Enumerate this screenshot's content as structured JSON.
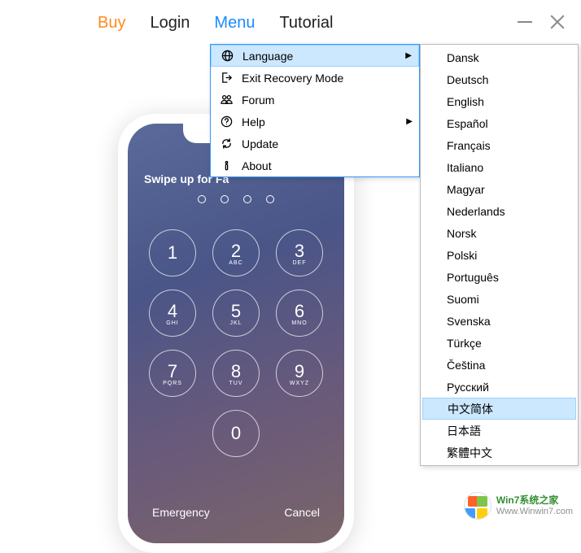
{
  "nav": {
    "buy": "Buy",
    "login": "Login",
    "menu": "Menu",
    "tutorial": "Tutorial"
  },
  "phone": {
    "swipe_text": "Swipe up for Fa",
    "keys": [
      {
        "num": "1",
        "ltr": ""
      },
      {
        "num": "2",
        "ltr": "ABC"
      },
      {
        "num": "3",
        "ltr": "DEF"
      },
      {
        "num": "4",
        "ltr": "GHI"
      },
      {
        "num": "5",
        "ltr": "JKL"
      },
      {
        "num": "6",
        "ltr": "MNO"
      },
      {
        "num": "7",
        "ltr": "PQRS"
      },
      {
        "num": "8",
        "ltr": "TUV"
      },
      {
        "num": "9",
        "ltr": "WXYZ"
      },
      {
        "num": "0",
        "ltr": ""
      }
    ],
    "emergency": "Emergency",
    "cancel": "Cancel"
  },
  "menu": {
    "items": [
      {
        "label": "Language",
        "icon": "globe",
        "arrow": true,
        "highlight": true
      },
      {
        "label": "Exit Recovery Mode",
        "icon": "exit",
        "arrow": false,
        "highlight": false
      },
      {
        "label": "Forum",
        "icon": "users",
        "arrow": false,
        "highlight": false
      },
      {
        "label": "Help",
        "icon": "help",
        "arrow": true,
        "highlight": false
      },
      {
        "label": "Update",
        "icon": "refresh",
        "arrow": false,
        "highlight": false
      },
      {
        "label": "About",
        "icon": "info",
        "arrow": false,
        "highlight": false
      }
    ]
  },
  "languages": [
    {
      "label": "Dansk",
      "highlight": false
    },
    {
      "label": "Deutsch",
      "highlight": false
    },
    {
      "label": "English",
      "highlight": false
    },
    {
      "label": "Español",
      "highlight": false
    },
    {
      "label": "Français",
      "highlight": false
    },
    {
      "label": "Italiano",
      "highlight": false
    },
    {
      "label": "Magyar",
      "highlight": false
    },
    {
      "label": "Nederlands",
      "highlight": false
    },
    {
      "label": "Norsk",
      "highlight": false
    },
    {
      "label": "Polski",
      "highlight": false
    },
    {
      "label": "Português",
      "highlight": false
    },
    {
      "label": "Suomi",
      "highlight": false
    },
    {
      "label": "Svenska",
      "highlight": false
    },
    {
      "label": "Türkçe",
      "highlight": false
    },
    {
      "label": "Čeština",
      "highlight": false
    },
    {
      "label": "Русский",
      "highlight": false
    },
    {
      "label": "中文简体",
      "highlight": true
    },
    {
      "label": "日本語",
      "highlight": false
    },
    {
      "label": "繁體中文",
      "highlight": false
    }
  ],
  "watermark": {
    "line1": "Win7系统之家",
    "line2": "Www.Winwin7.com"
  }
}
